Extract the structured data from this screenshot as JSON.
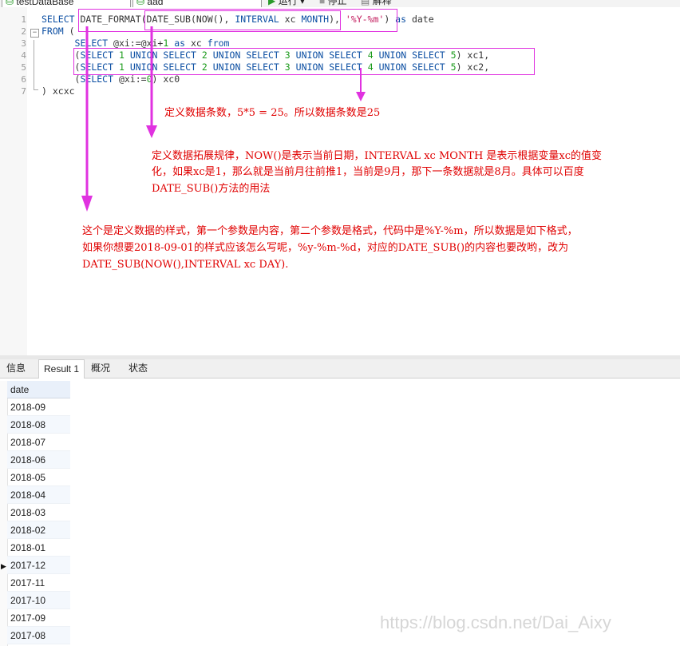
{
  "toolbar": {
    "database_select": "testDataBase",
    "schema_select": "aad",
    "run_label": "运行",
    "stop_label": "停止",
    "explain_label": "解释"
  },
  "editor": {
    "line_numbers": [
      "1",
      "2",
      "3",
      "4",
      "5",
      "6",
      "7"
    ]
  },
  "annotations": {
    "note1": "定义数据条数，5*5 = 25。所以数据条数是25",
    "note2_line1": "定义数据拓展规律，NOW()是表示当前日期，INTERVAL xc MONTH 是表示根据变量xc的值变",
    "note2_line2": "化，如果xc是1，那么就是当前月往前推1，当前是9月，那下一条数据就是8月。具体可以百度",
    "note2_line3": "DATE_SUB()方法的用法",
    "note3_line1": "这个是定义数据的样式，第一个参数是内容，第二个参数是格式，代码中是%Y-%m，所以数据是如下格式，",
    "note3_line2": "如果你想要2018-09-01的样式应该怎么写呢，%y-%m-%d，对应的DATE_SUB()的内容也要改哟，改为",
    "note3_line3": "DATE_SUB(NOW(),INTERVAL xc DAY).",
    "color": "#e00000",
    "box_color": "#e032e0"
  },
  "tabs": [
    {
      "label": "信息"
    },
    {
      "label": "Result 1"
    },
    {
      "label": "概况"
    },
    {
      "label": "状态"
    }
  ],
  "result": {
    "column": "date",
    "rows": [
      "2018-09",
      "2018-08",
      "2018-07",
      "2018-06",
      "2018-05",
      "2018-04",
      "2018-03",
      "2018-02",
      "2018-01",
      "2017-12",
      "2017-11",
      "2017-10",
      "2017-09",
      "2017-08"
    ]
  },
  "watermark": "https://blog.csdn.net/Dai_Aixy"
}
